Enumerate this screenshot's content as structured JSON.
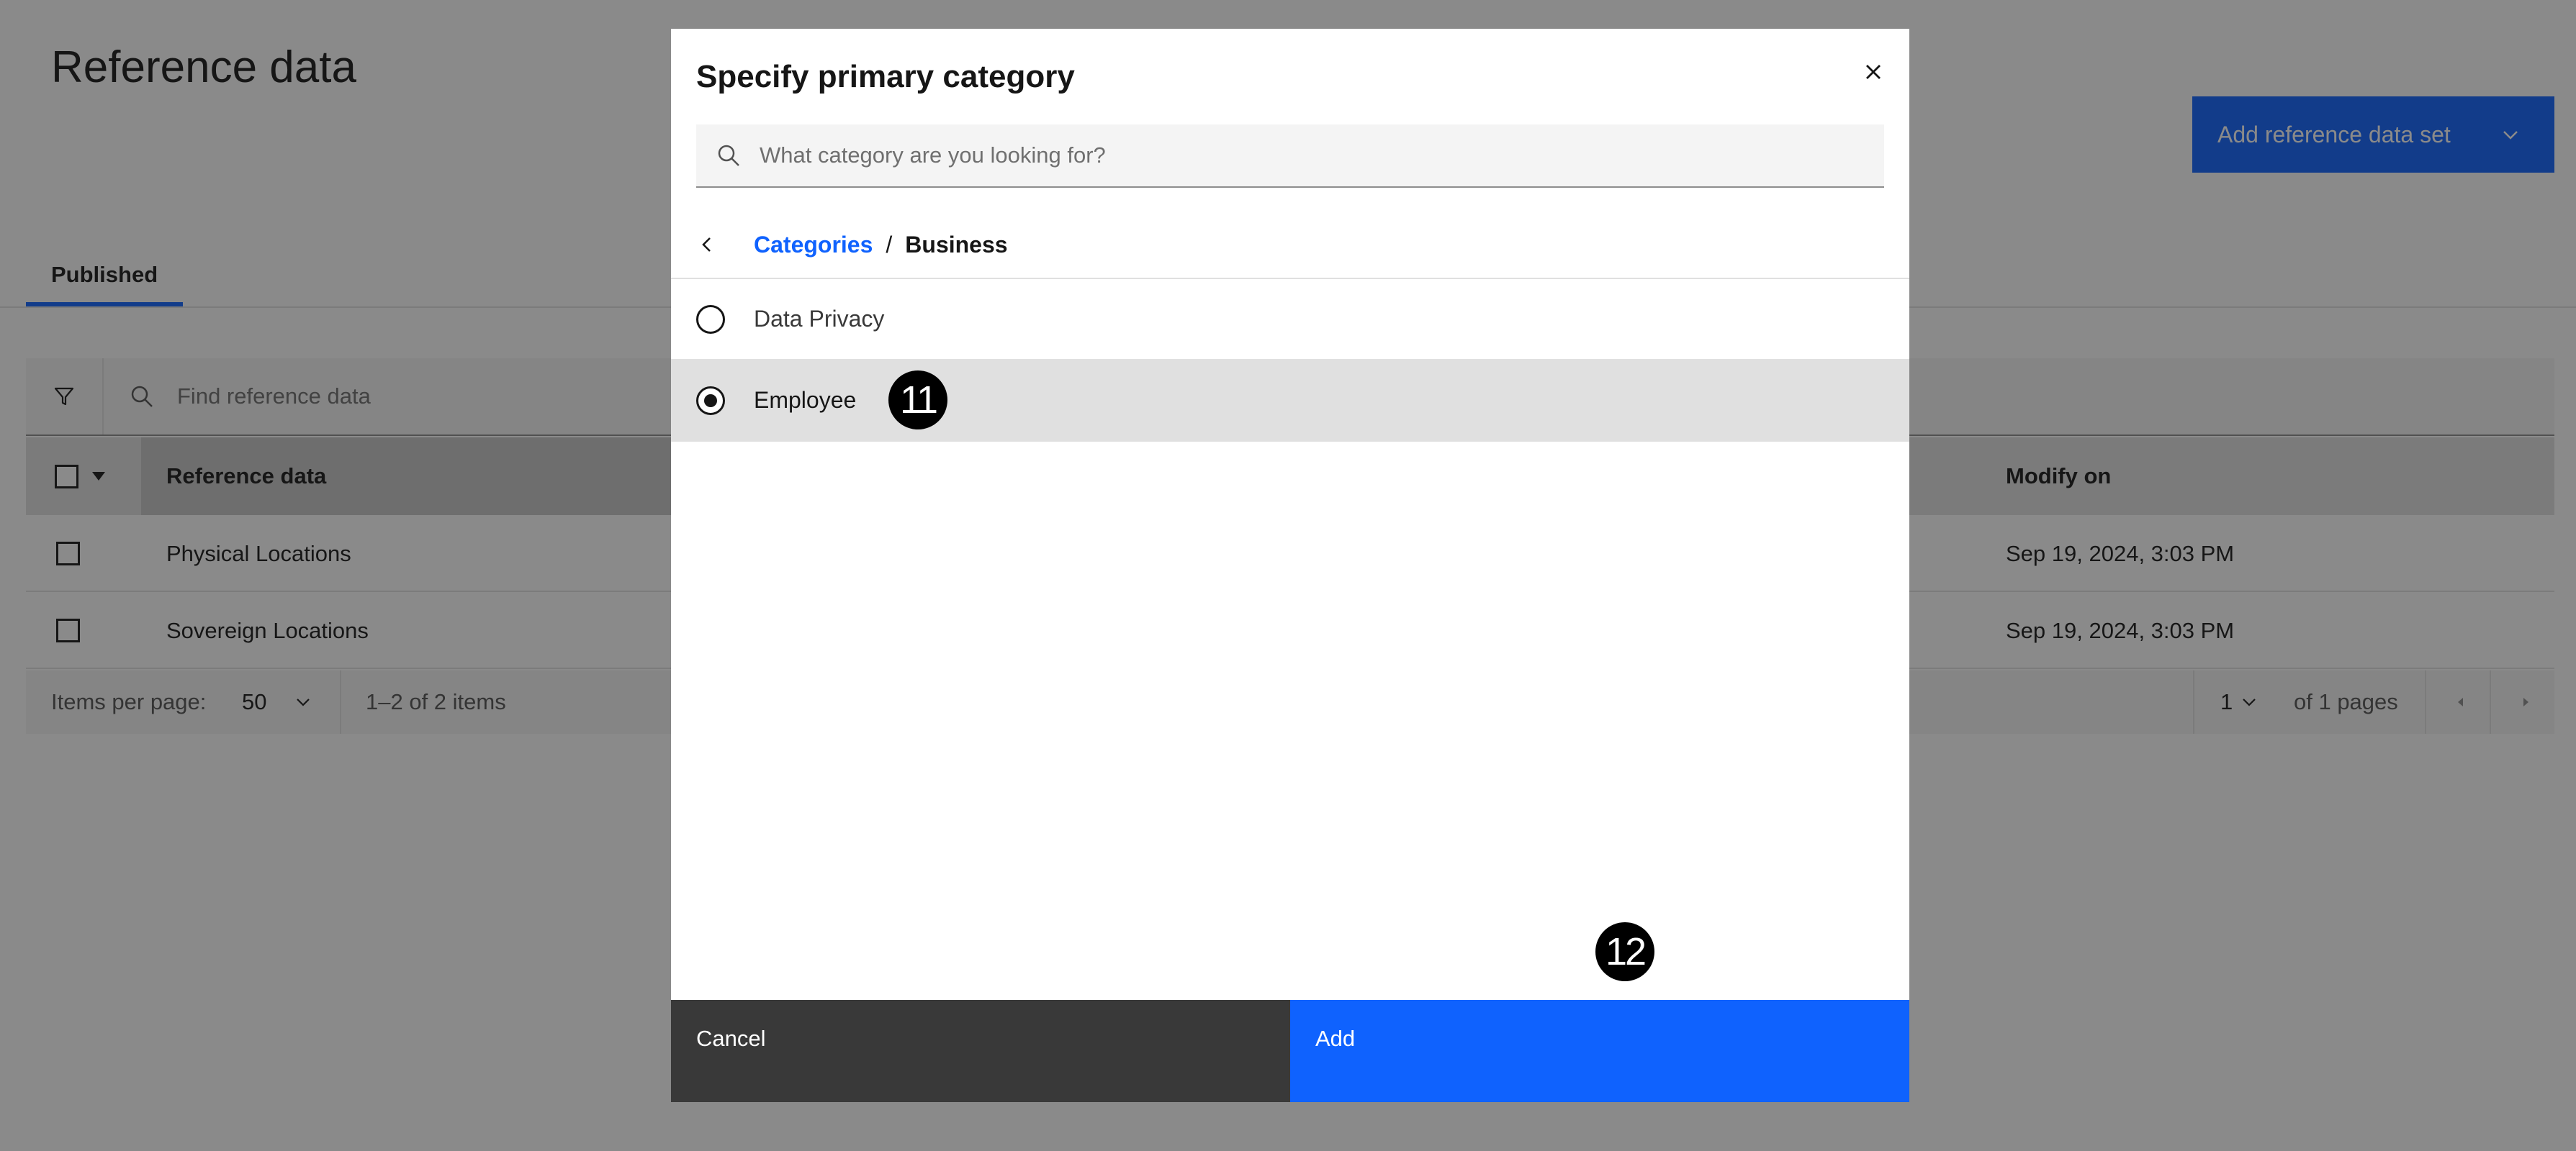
{
  "page": {
    "title": "Reference data",
    "add_button_label": "Add reference data set",
    "tabs": [
      {
        "label": "Published"
      }
    ],
    "search_placeholder": "Find reference data",
    "table": {
      "columns": [
        "Reference data",
        "Modify on"
      ],
      "rows": [
        {
          "name": "Physical Locations",
          "modified": "Sep 19, 2024, 3:03 PM"
        },
        {
          "name": "Sovereign Locations",
          "modified": "Sep 19, 2024, 3:03 PM"
        }
      ]
    },
    "pagination": {
      "items_per_page_label": "Items per page:",
      "items_per_page": "50",
      "range": "1–2 of 2 items",
      "page": "1",
      "of_pages": "of 1 pages"
    }
  },
  "modal": {
    "title": "Specify primary category",
    "search_placeholder": "What category are you looking for?",
    "breadcrumb": {
      "link": "Categories",
      "separator": "/",
      "current": "Business"
    },
    "options": [
      {
        "label": "Data Privacy",
        "selected": false
      },
      {
        "label": "Employee",
        "selected": true
      }
    ],
    "cancel_label": "Cancel",
    "add_label": "Add"
  },
  "annotations": {
    "step_a": "11",
    "step_b": "12"
  },
  "colors": {
    "primary": "#0f62fe",
    "secondary_button": "#393939",
    "overlay": "rgba(22,22,22,0.5)"
  }
}
